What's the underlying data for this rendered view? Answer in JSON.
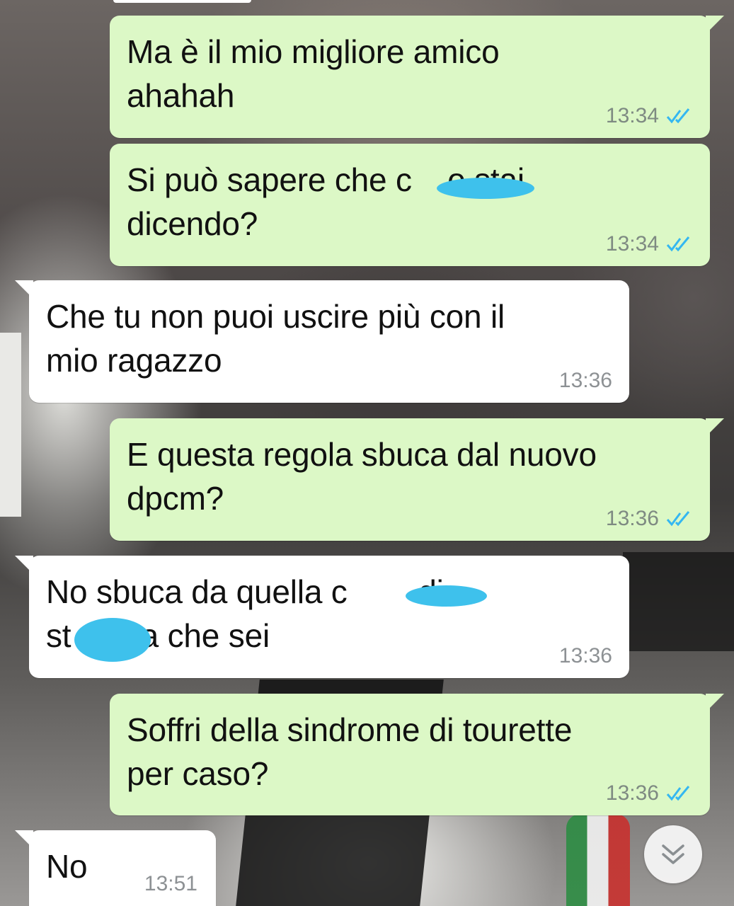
{
  "messages": [
    {
      "direction": "out",
      "text": "Ma è il mio migliore amico\nahahah",
      "time": "13:34",
      "status": "read"
    },
    {
      "direction": "out",
      "text": "Si può sapere che c    o stai\ndicendo?",
      "time": "13:34",
      "status": "read"
    },
    {
      "direction": "in",
      "text": "Che tu non puoi uscire più con il\nmio ragazzo",
      "time": "13:36"
    },
    {
      "direction": "out",
      "text": "E questa regola sbuca dal nuovo\ndpcm?",
      "time": "13:36",
      "status": "read"
    },
    {
      "direction": "in",
      "text": "No sbuca da quella c        di\nst      za che sei",
      "time": "13:36"
    },
    {
      "direction": "out",
      "text": "Soffri della sindrome di tourette\nper caso?",
      "time": "13:36",
      "status": "read"
    },
    {
      "direction": "in",
      "text": "No",
      "time": "13:51"
    }
  ],
  "colors": {
    "outgoing_bubble": "#dcf8c6",
    "incoming_bubble": "#ffffff",
    "read_ticks": "#34b7f1",
    "censor_mark": "#3ec1ec"
  },
  "icons": {
    "read_status": "double-check-icon",
    "scroll_down": "double-chevron-down-icon"
  }
}
